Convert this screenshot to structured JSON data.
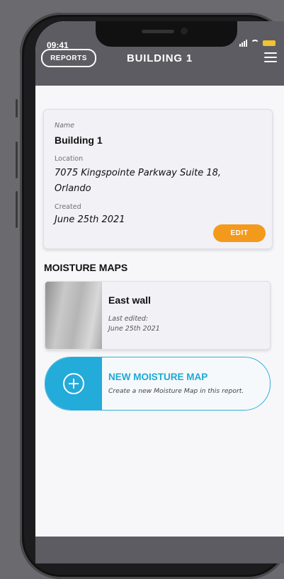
{
  "status": {
    "time": "09:41"
  },
  "header": {
    "reports_label": "REPORTS",
    "title": "BUILDING 1"
  },
  "info": {
    "name_label": "Name",
    "name_value": "Building 1",
    "location_label": "Location",
    "location_line1": "7075 Kingspointe Parkway Suite 18,",
    "location_line2": "Orlando",
    "created_label": "Created",
    "created_value": "June 25th 2021",
    "edit_label": "EDIT"
  },
  "moisture_maps": {
    "section_title": "MOISTURE MAPS",
    "items": [
      {
        "name": "East wall",
        "edited_label": "Last edited:",
        "edited_value": "June 25th 2021"
      }
    ],
    "new_title": "NEW MOISTURE MAP",
    "new_subtitle": "Create a new Moisture Map in this report."
  },
  "colors": {
    "header": "#5d5c63",
    "accent_orange": "#f39a1c",
    "accent_blue": "#23abd9",
    "battery": "#f2c230"
  },
  "icons": [
    "wifi-icon",
    "signal-icon",
    "battery-icon",
    "hamburger-menu-icon",
    "plus-circle-icon"
  ]
}
